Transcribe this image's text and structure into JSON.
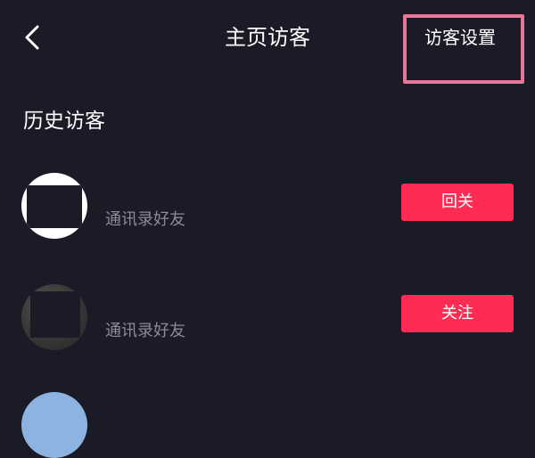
{
  "header": {
    "title": "主页访客",
    "settings_label": "访客设置",
    "back_icon": "chevron-left-icon",
    "highlight_color": "#e8769a"
  },
  "section": {
    "heading": "历史访客"
  },
  "visitors": [
    {
      "source": "通讯录好友",
      "action": "回关"
    },
    {
      "source": "通讯录好友",
      "action": "关注"
    }
  ],
  "colors": {
    "background": "#1b1a27",
    "button": "#fe2c55",
    "secondary_text": "#8c8b96"
  }
}
